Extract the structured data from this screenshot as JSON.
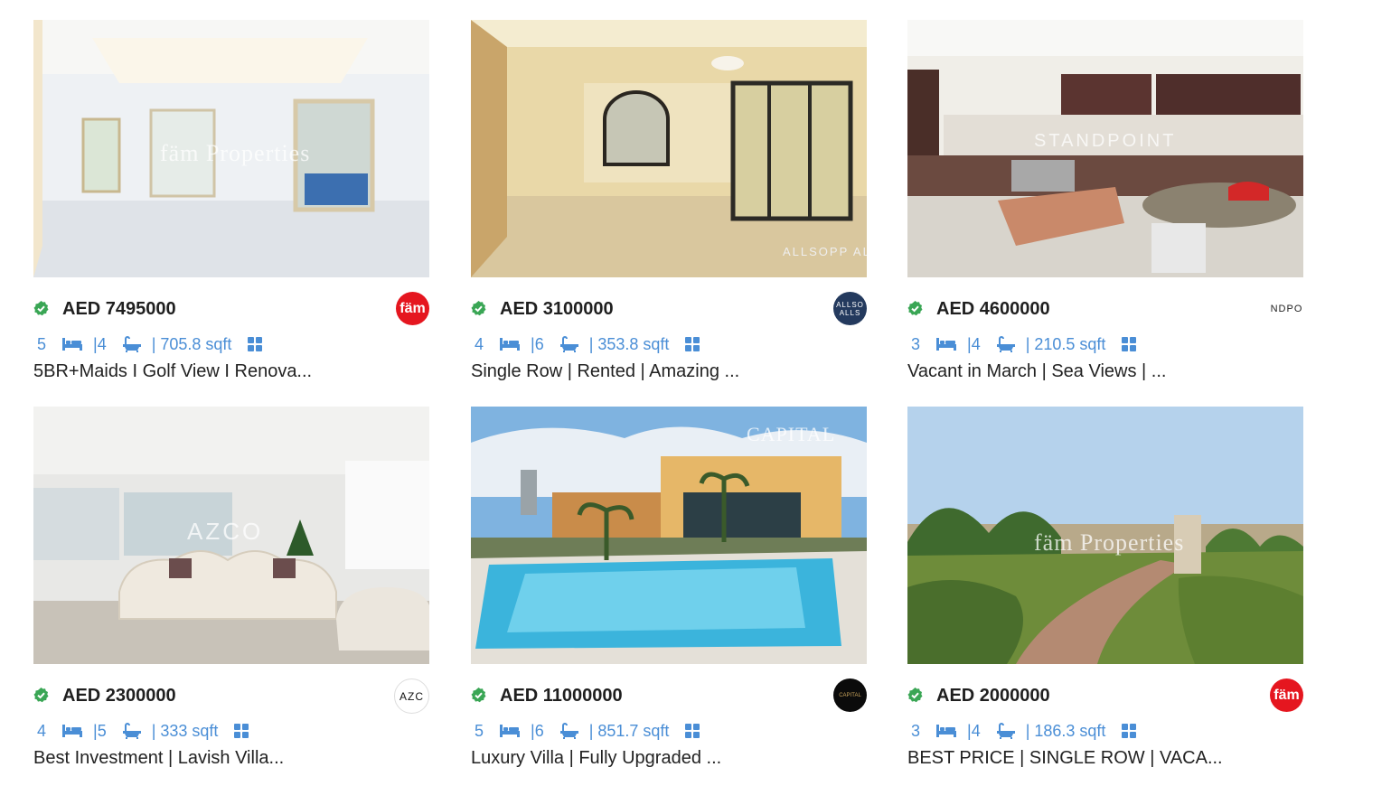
{
  "listings": [
    {
      "price": "AED 7495000",
      "beds": "5",
      "baths": "|4",
      "area": "| 705.8 sqft",
      "title": "5BR+Maids I Golf View I Renova...",
      "watermark": "fäm Properties",
      "agency_logo_text": "fäm"
    },
    {
      "price": "AED 3100000",
      "beds": "4",
      "baths": "|6",
      "area": "| 353.8 sqft",
      "title": "Single Row | Rented | Amazing ...",
      "watermark": "ALLSOPP ALLSOPP",
      "agency_logo_text": "ALLSO ALLS"
    },
    {
      "price": "AED 4600000",
      "beds": "3",
      "baths": "|4",
      "area": "| 210.5 sqft",
      "title": "Vacant in March | Sea Views | ...",
      "watermark": "STANDPOINT",
      "agency_logo_text": "NDPO"
    },
    {
      "price": "AED 2300000",
      "beds": "4",
      "baths": "|5",
      "area": "| 333 sqft",
      "title": "Best Investment | Lavish Villa...",
      "watermark": "AZCO",
      "agency_logo_text": "AZC"
    },
    {
      "price": "AED 11000000",
      "beds": "5",
      "baths": "|6",
      "area": "| 851.7 sqft",
      "title": "Luxury Villa | Fully Upgraded ...",
      "watermark": "CAPITAL",
      "agency_logo_text": "CAPITAL"
    },
    {
      "price": "AED 2000000",
      "beds": "3",
      "baths": "|4",
      "area": "| 186.3 sqft",
      "title": "BEST PRICE | SINGLE ROW | VACA...",
      "watermark": "fäm Properties",
      "agency_logo_text": "fäm"
    }
  ],
  "colors": {
    "accent": "#4a8ed6",
    "verified": "#3aa655",
    "fam_red": "#e5161f"
  }
}
